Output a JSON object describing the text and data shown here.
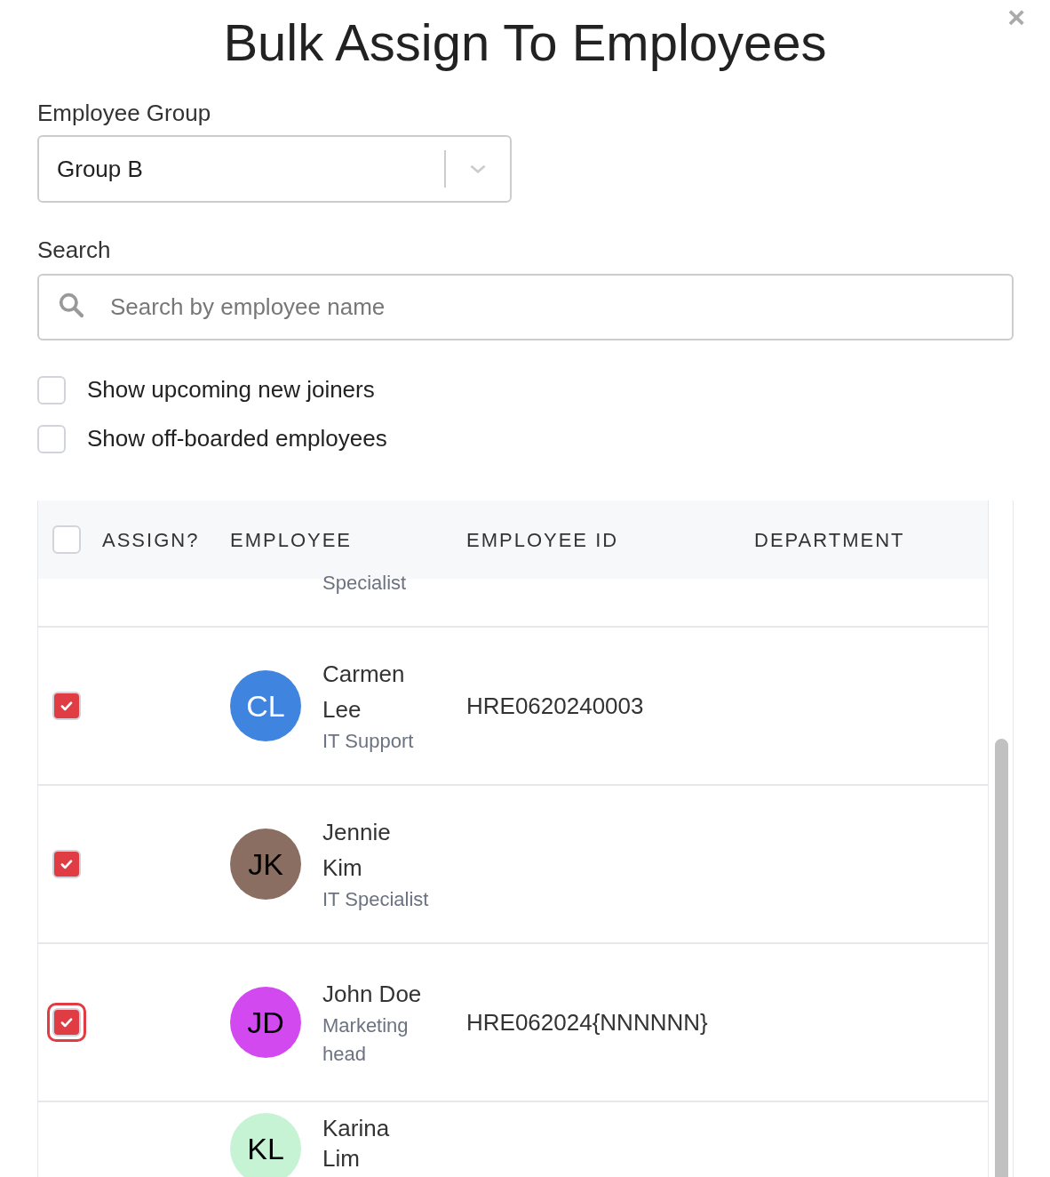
{
  "dialog": {
    "title": "Bulk Assign To Employees",
    "close": "×"
  },
  "employee_group": {
    "label": "Employee Group",
    "value": "Group B"
  },
  "search": {
    "label": "Search",
    "placeholder": "Search by employee name"
  },
  "filters": [
    {
      "label": "Show upcoming new joiners",
      "checked": false
    },
    {
      "label": "Show off-boarded employees",
      "checked": false
    }
  ],
  "table": {
    "select_all": {
      "checked": false
    },
    "columns": [
      "ASSIGN?",
      "EMPLOYEE",
      "EMPLOYEE ID",
      "DEPARTMENT"
    ],
    "rows": [
      {
        "kind": "partial",
        "role": "Specialist"
      },
      {
        "kind": "employee",
        "checked": true,
        "focused": false,
        "initials": "CL",
        "color": "#3f85e0",
        "name": "Carmen Lee",
        "role": "IT Support",
        "employee_id": "HRE0620240003"
      },
      {
        "kind": "employee",
        "checked": true,
        "focused": false,
        "initials": "JK",
        "color": "#8b6e62",
        "name": "Jennie Kim",
        "role": "IT Specialist"
      },
      {
        "kind": "employee",
        "checked": true,
        "focused": true,
        "initials": "JD",
        "color": "#d24aef",
        "name": "John Doe",
        "role": "Marketing head",
        "employee_id": "HRE062024{NNNNNN}"
      },
      {
        "kind": "employee",
        "initials": "KL",
        "color": "#c6f3d3",
        "name": "Karina Lim"
      }
    ]
  }
}
